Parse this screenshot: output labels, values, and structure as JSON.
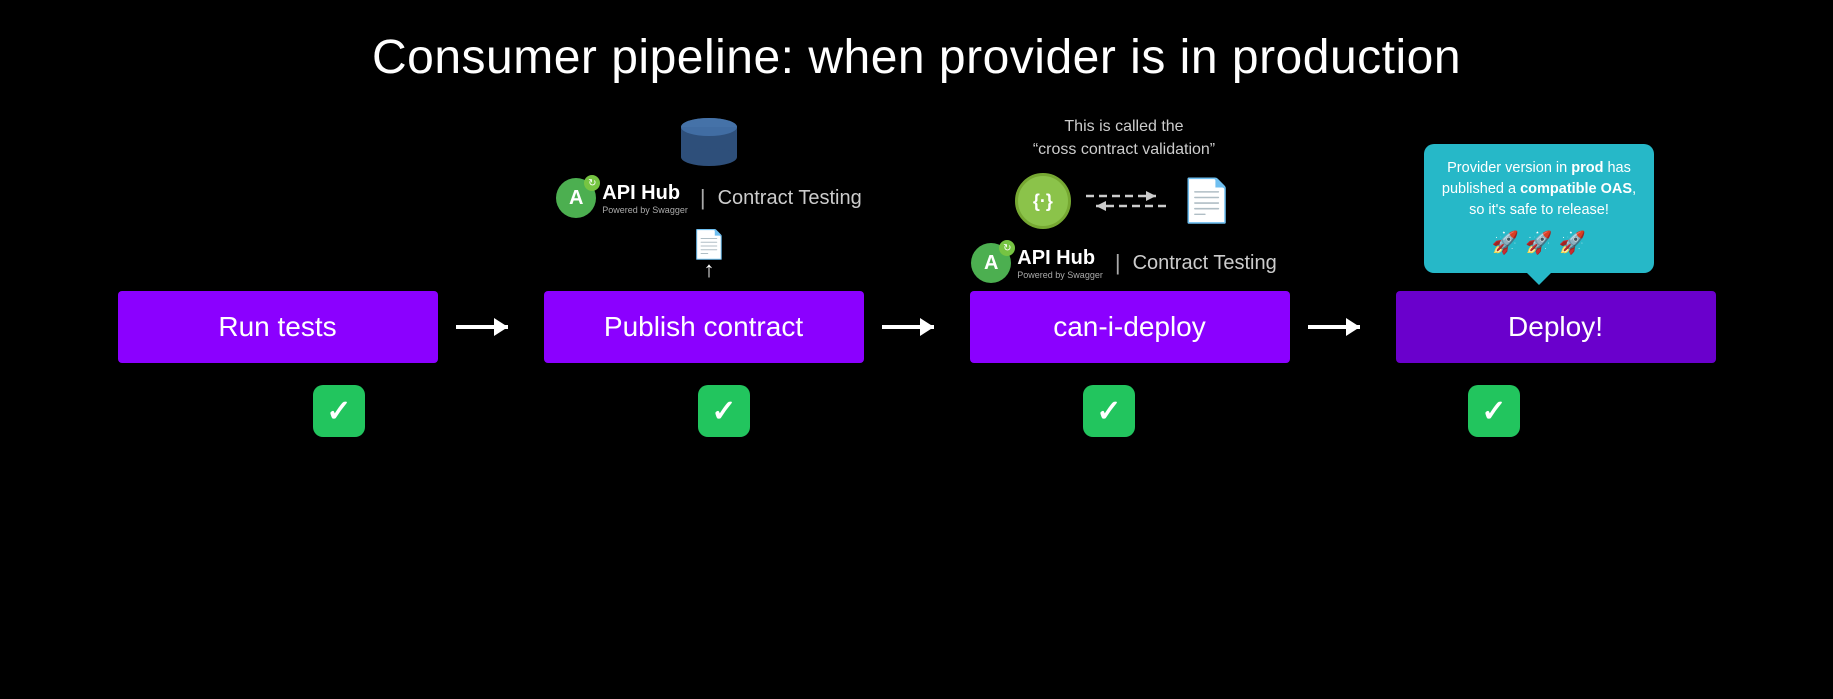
{
  "title": "Consumer pipeline: when provider is in production",
  "pipeline": {
    "steps": [
      {
        "id": "run-tests",
        "label": "Run tests",
        "variant": "purple"
      },
      {
        "id": "publish-contract",
        "label": "Publish contract",
        "variant": "purple"
      },
      {
        "id": "can-i-deploy",
        "label": "can-i-deploy",
        "variant": "purple"
      },
      {
        "id": "deploy",
        "label": "Deploy!",
        "variant": "dark-purple"
      }
    ],
    "arrows": [
      "→",
      "→",
      "→"
    ]
  },
  "annotations": {
    "publish": {
      "api_hub_name": "API Hub",
      "api_hub_powered": "Powered by Swagger",
      "api_hub_service": "Contract Testing",
      "upload_symbol": "📄↑"
    },
    "can_i_deploy": {
      "callout_line1": "This is called the",
      "callout_line2": "“cross contract validation”"
    },
    "deploy": {
      "bubble_text_prefix": "Provider version in ",
      "bubble_prod": "prod",
      "bubble_text_mid": " has published a ",
      "bubble_compatible": "compatible OAS",
      "bubble_text_suffix": ", so it’s safe to release!",
      "rockets": "🚀 🚀 🚀"
    }
  },
  "checkmarks": [
    "✓",
    "✓",
    "✓",
    "✓"
  ],
  "colors": {
    "background": "#000000",
    "step_purple": "#8b00ff",
    "step_dark_purple": "#6a00cc",
    "bubble_teal": "#26b8c8",
    "check_green": "#22c55e"
  }
}
